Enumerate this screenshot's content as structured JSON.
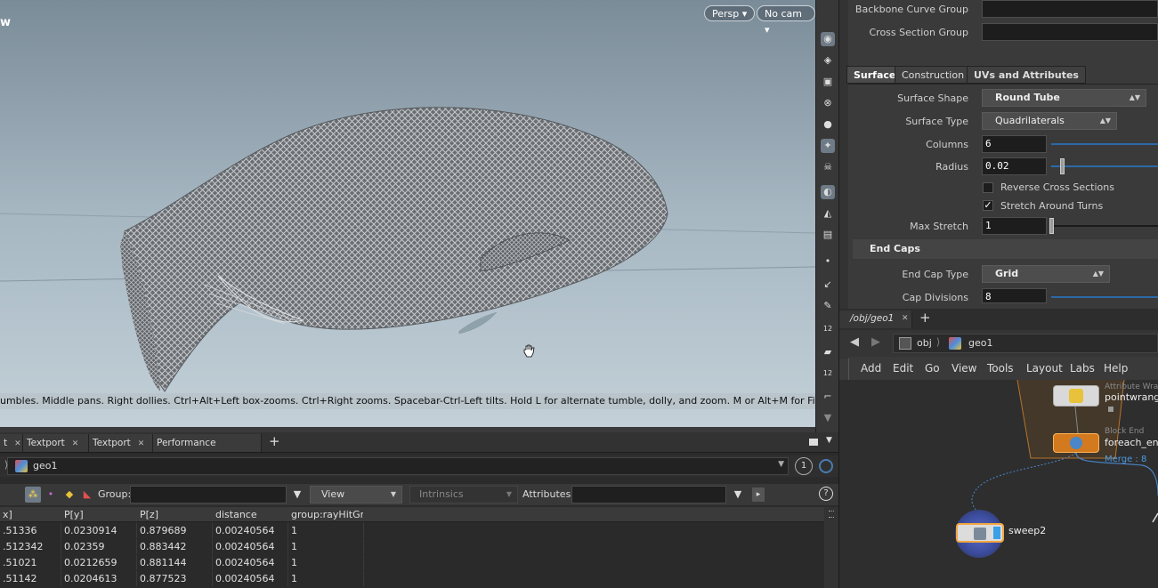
{
  "viewport": {
    "title_fragment": "w",
    "persp_label": "Persp",
    "cam_label": "No cam",
    "hint": "umbles. Middle pans. Right dollies. Ctrl+Alt+Left box-zooms. Ctrl+Right zooms. Spacebar-Ctrl-Left tilts. Hold L for alternate tumble, dolly, and zoom. M or Alt+M for First Person",
    "toolbar_badges": [
      "12",
      "12"
    ]
  },
  "lower_tabs": [
    {
      "label": "t"
    },
    {
      "label": "Textport"
    },
    {
      "label": "Textport"
    },
    {
      "label": "Performance Monitor"
    }
  ],
  "path": {
    "node": "geo1",
    "badge": "1"
  },
  "spreadsheet": {
    "group_label": "Group:",
    "view_label": "View",
    "intrinsics_label": "Intrinsics",
    "attributes_label": "Attributes:",
    "columns": [
      "x]",
      "P[y]",
      "P[z]",
      "distance",
      "group:rayHitGr"
    ],
    "rows": [
      [
        ".51336",
        "0.0230914",
        "0.879689",
        "0.00240564",
        "1"
      ],
      [
        ".512342",
        "0.02359",
        "0.883442",
        "0.00240564",
        "1"
      ],
      [
        ".51021",
        "0.0212659",
        "0.881144",
        "0.00240564",
        "1"
      ],
      [
        ".51142",
        "0.0204613",
        "0.877523",
        "0.00240564",
        "1"
      ]
    ]
  },
  "params": {
    "backbone_label": "Backbone Curve Group",
    "cross_label": "Cross Section Group",
    "tabs": [
      "Surface",
      "Construction",
      "UVs and Attributes"
    ],
    "surface_shape_label": "Surface Shape",
    "surface_shape_value": "Round Tube",
    "surface_type_label": "Surface Type",
    "surface_type_value": "Quadrilaterals",
    "columns_label": "Columns",
    "columns_value": "6",
    "radius_label": "Radius",
    "radius_value": "0.02",
    "reverse_label": "Reverse Cross Sections",
    "stretch_label": "Stretch Around Turns",
    "max_stretch_label": "Max Stretch",
    "max_stretch_value": "1",
    "end_caps_label": "End Caps",
    "end_cap_type_label": "End Cap Type",
    "end_cap_type_value": "Grid",
    "cap_div_label": "Cap Divisions",
    "cap_div_value": "8"
  },
  "network": {
    "tab_label": "/obj/geo1",
    "path_obj": "obj",
    "path_geo": "geo1",
    "menu": [
      "Add",
      "Edit",
      "Go",
      "View",
      "Tools",
      "Layout",
      "Labs",
      "Help"
    ],
    "node1_sub": "Attribute Wran",
    "node1_label": "pointwrangl",
    "node2_sub": "Block End",
    "node2_label": "foreach_end",
    "node2_merge": "Merge : 8",
    "node3_label": "sweep2"
  }
}
